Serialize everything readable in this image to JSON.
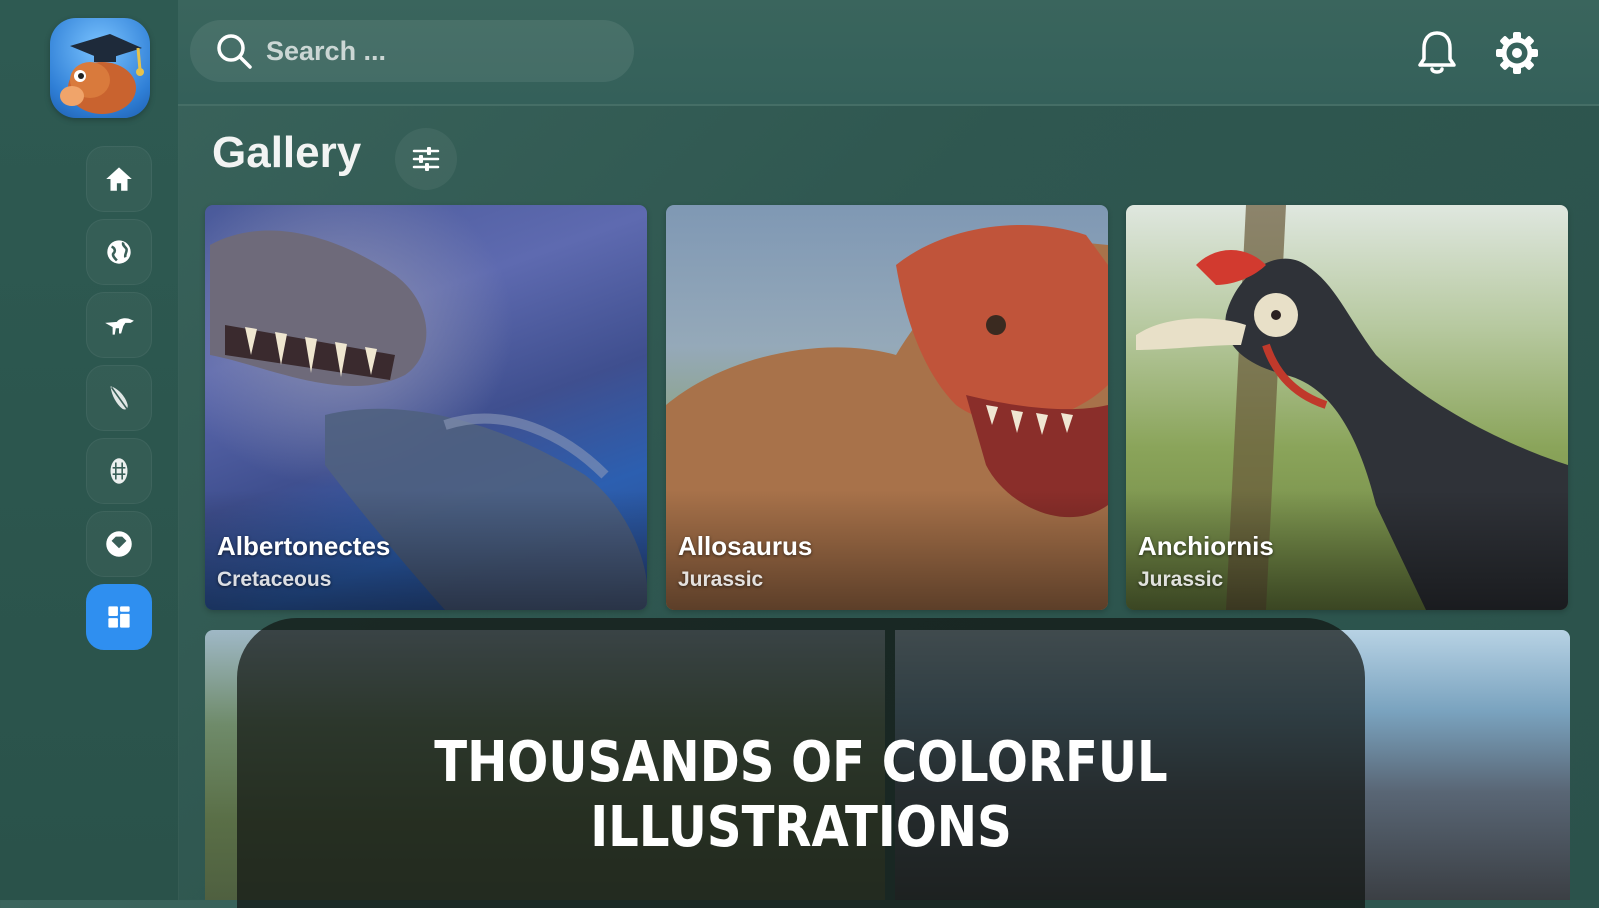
{
  "app": {
    "logo_icon": "dinosaur-graduate-logo"
  },
  "sidebar": {
    "items": [
      {
        "icon": "home-icon",
        "active": false
      },
      {
        "icon": "globe-icon",
        "active": false
      },
      {
        "icon": "dinosaur-icon",
        "active": false
      },
      {
        "icon": "feather-icon",
        "active": false
      },
      {
        "icon": "fossil-icon",
        "active": false
      },
      {
        "icon": "badge-icon",
        "active": false
      },
      {
        "icon": "gallery-grid-icon",
        "active": true
      }
    ],
    "accent_color": "#2f8ff0"
  },
  "topbar": {
    "search_placeholder": "Search ...",
    "notification_icon": "bell-icon",
    "settings_icon": "gear-icon"
  },
  "gallery": {
    "title": "Gallery",
    "filter_icon": "sliders-icon",
    "cards": [
      {
        "name": "Albertonectes",
        "era": "Cretaceous"
      },
      {
        "name": "Allosaurus",
        "era": "Jurassic"
      },
      {
        "name": "Anchiornis",
        "era": "Jurassic"
      }
    ]
  },
  "banner": {
    "text": "THOUSANDS OF COLORFUL ILLUSTRATIONS"
  }
}
